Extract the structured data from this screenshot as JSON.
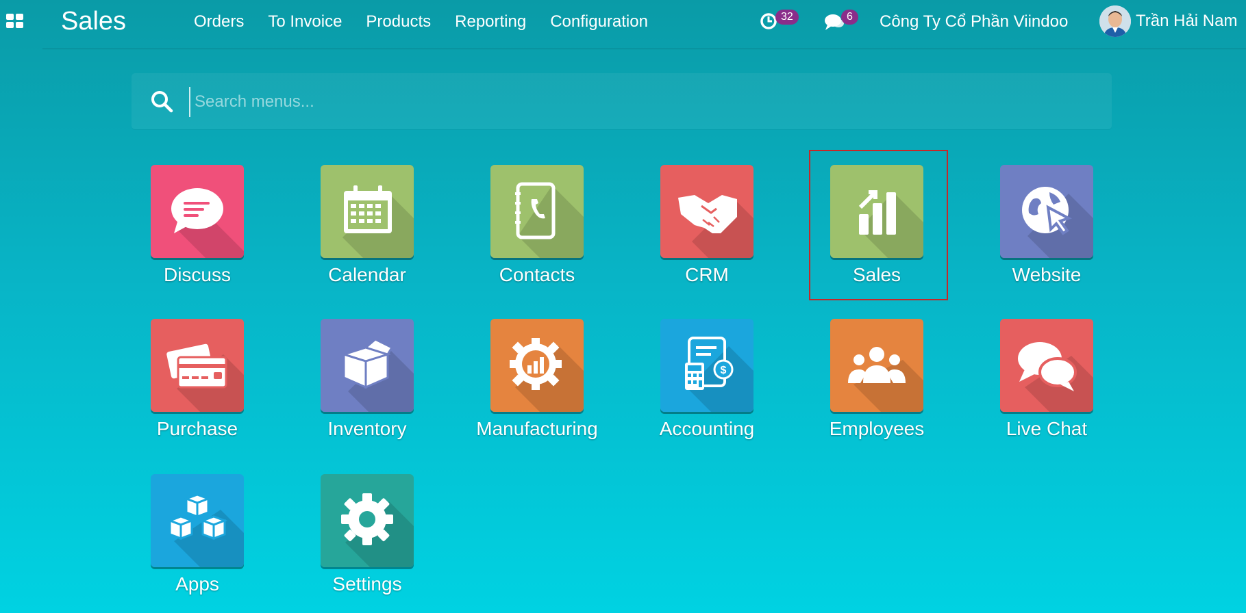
{
  "topbar": {
    "brand": "Sales",
    "menu": [
      "Orders",
      "To Invoice",
      "Products",
      "Reporting",
      "Configuration"
    ],
    "activity_count": "32",
    "messages_count": "6",
    "company": "Công Ty Cổ Phần Viindoo",
    "user_name": "Trần Hải Nam"
  },
  "search": {
    "placeholder": "Search menus..."
  },
  "apps": [
    {
      "label": "Discuss",
      "color": "#f0507a",
      "icon": "chat-bubble-icon"
    },
    {
      "label": "Calendar",
      "color": "#9ec16c",
      "icon": "calendar-icon"
    },
    {
      "label": "Contacts",
      "color": "#9ec16c",
      "icon": "address-book-icon"
    },
    {
      "label": "CRM",
      "color": "#e65f5f",
      "icon": "handshake-icon"
    },
    {
      "label": "Sales",
      "color": "#9ec16c",
      "icon": "sales-chart-icon"
    },
    {
      "label": "Website",
      "color": "#6f7fc3",
      "icon": "globe-cursor-icon"
    },
    {
      "label": "Purchase",
      "color": "#e65f5f",
      "icon": "credit-card-icon"
    },
    {
      "label": "Inventory",
      "color": "#6f7fc3",
      "icon": "box-icon"
    },
    {
      "label": "Manufacturing",
      "color": "#e5843f",
      "icon": "gear-chart-icon"
    },
    {
      "label": "Accounting",
      "color": "#1ba6dd",
      "icon": "invoice-calculator-icon"
    },
    {
      "label": "Employees",
      "color": "#e5843f",
      "icon": "people-icon"
    },
    {
      "label": "Live Chat",
      "color": "#e65f5f",
      "icon": "chat-bubbles-icon"
    },
    {
      "label": "Apps",
      "color": "#1ba6dd",
      "icon": "cubes-icon"
    },
    {
      "label": "Settings",
      "color": "#26a69a",
      "icon": "gear-icon"
    }
  ],
  "selected_app": "Sales"
}
